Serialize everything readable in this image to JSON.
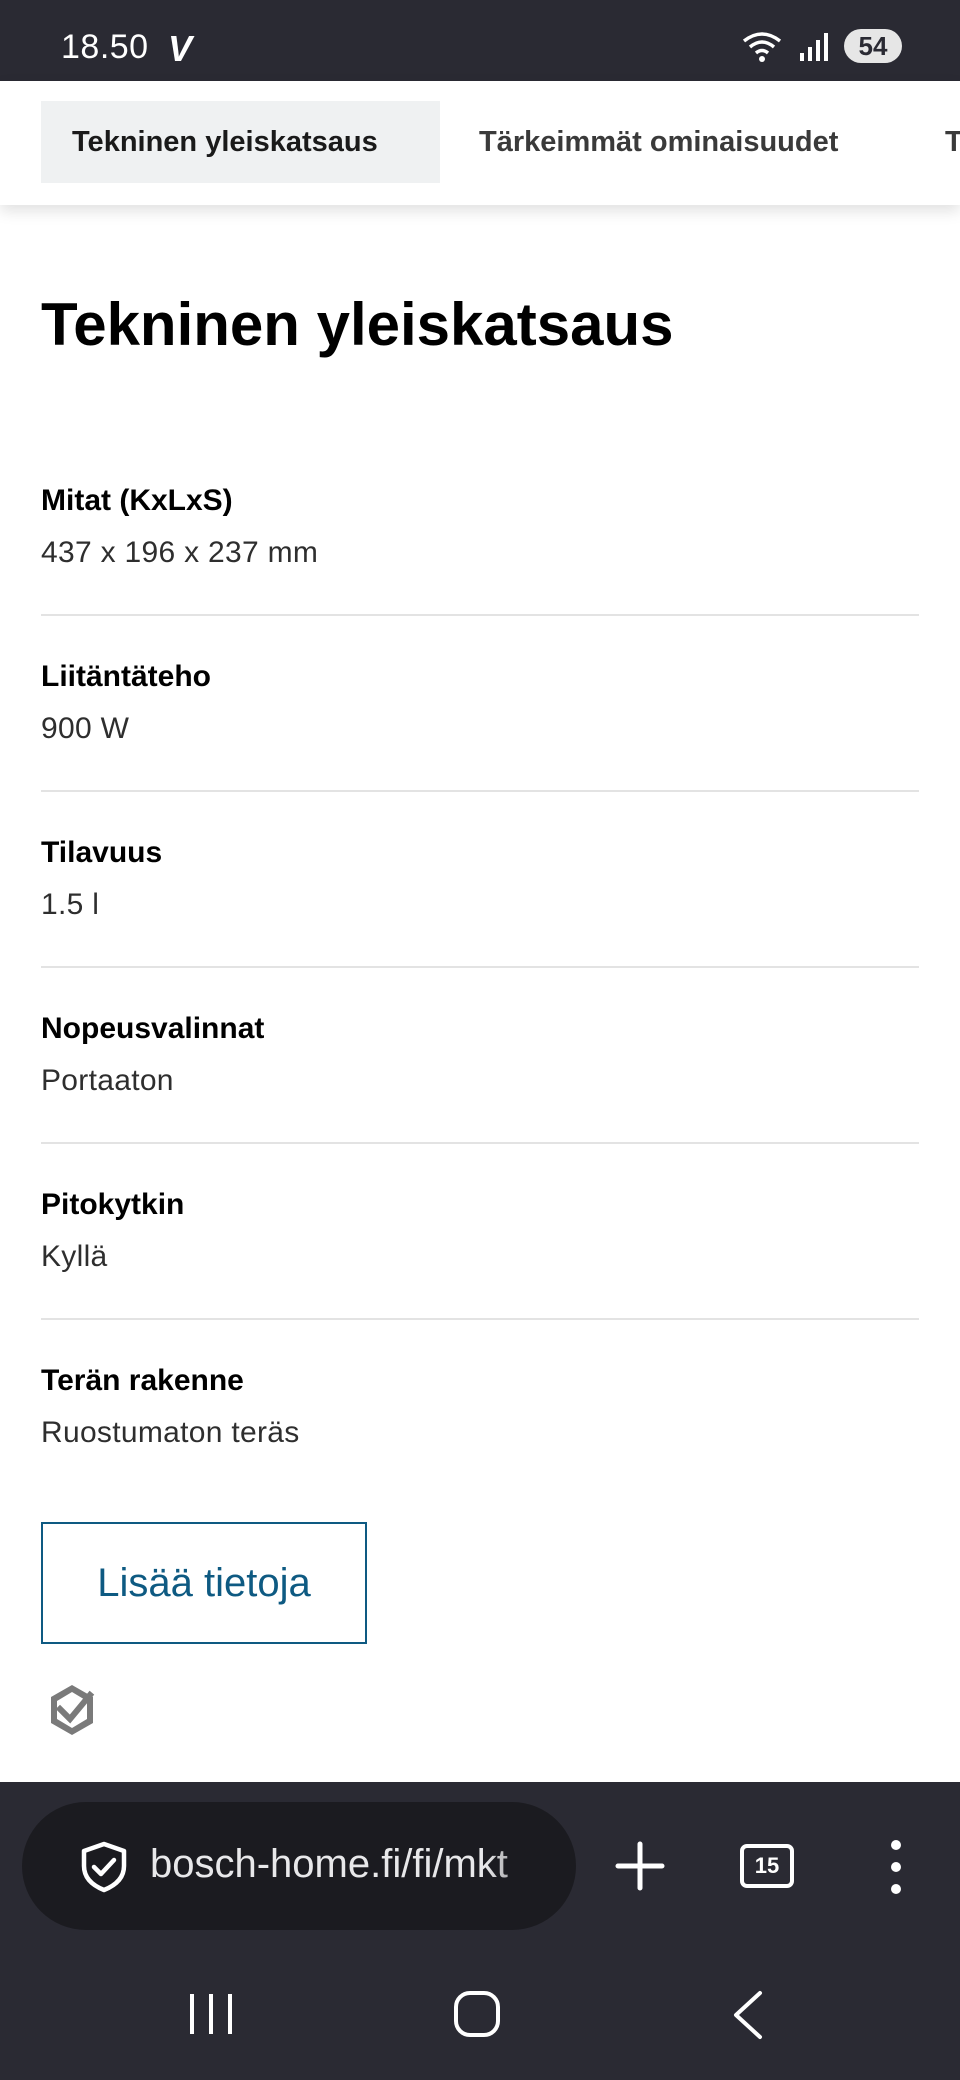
{
  "status_bar": {
    "time": "18.50",
    "carrier_mark": "V",
    "battery": "54"
  },
  "tabs": [
    {
      "label": "Tekninen yleiskatsaus",
      "active": true
    },
    {
      "label": "Tärkeimmät ominaisuudet",
      "active": false
    },
    {
      "label": "T",
      "active": false
    }
  ],
  "page_title": "Tekninen yleiskatsaus",
  "specs": [
    {
      "label": "Mitat (KxLxS)",
      "value": "437 x 196 x 237 mm"
    },
    {
      "label": "Liitäntäteho",
      "value": "900 W"
    },
    {
      "label": "Tilavuus",
      "value": "1.5 l"
    },
    {
      "label": "Nopeusvalinnat",
      "value": "Portaaton"
    },
    {
      "label": "Pitokytkin",
      "value": "Kyllä"
    },
    {
      "label": "Terän rakenne",
      "value": "Ruostumaton teräs"
    }
  ],
  "more_button": "Lisää tietoja",
  "browser": {
    "url": "bosch-home.fi/fi/mkt",
    "tab_count": "15"
  },
  "icons": {
    "security": "shield-check-icon",
    "new_tab": "plus-icon",
    "tabs": "tabs-count-icon",
    "menu": "more-vert-icon",
    "badge": "check-badge-icon"
  },
  "colors": {
    "accent": "#0e5a82",
    "system_bar": "#2a2a33"
  }
}
